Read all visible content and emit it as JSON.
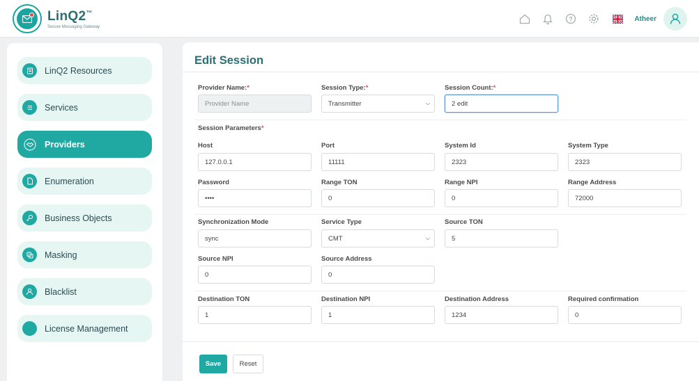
{
  "header": {
    "brand": "LinQ2",
    "brand_sup": "™",
    "tagline": "Secure Messaging Gateway",
    "username": "Atheer",
    "icons": [
      "home-icon",
      "bell-icon",
      "help-icon",
      "gear-icon",
      "uk-flag-icon",
      "user-avatar-icon"
    ]
  },
  "sidebar": {
    "items": [
      {
        "label": "LinQ2 Resources",
        "icon": "resources-icon"
      },
      {
        "label": "Services",
        "icon": "services-icon"
      },
      {
        "label": "Providers",
        "icon": "providers-icon",
        "active": true
      },
      {
        "label": "Enumeration",
        "icon": "document-icon"
      },
      {
        "label": "Business Objects",
        "icon": "key-icon"
      },
      {
        "label": "Masking",
        "icon": "masking-icon"
      },
      {
        "label": "Blacklist",
        "icon": "blocked-user-icon"
      },
      {
        "label": "License Management",
        "icon": "license-icon"
      }
    ]
  },
  "form": {
    "title": "Edit Session",
    "provider_name": {
      "label": "Provider Name:",
      "required": "*",
      "placeholder": "Provider Name"
    },
    "session_type": {
      "label": "Session Type:",
      "required": "*",
      "value": "Transmitter"
    },
    "session_count": {
      "label": "Session Count:",
      "required": "*",
      "value": "2 edit"
    },
    "session_parameters_label": "Session Parameters",
    "session_parameters_required": "*",
    "host": {
      "label": "Host",
      "value": "127.0.0.1"
    },
    "port": {
      "label": "Port",
      "value": "11111"
    },
    "system_id": {
      "label": "System Id",
      "value": "2323"
    },
    "system_type": {
      "label": "System Type",
      "value": "2323"
    },
    "password": {
      "label": "Password",
      "value": "••••"
    },
    "range_ton": {
      "label": "Range TON",
      "value": "0"
    },
    "range_npi": {
      "label": "Range NPI",
      "value": "0"
    },
    "range_address": {
      "label": "Range Address",
      "value": "72000"
    },
    "sync_mode": {
      "label": "Synchronization Mode",
      "value": "sync"
    },
    "service_type": {
      "label": "Service Type",
      "value": "CMT"
    },
    "source_ton": {
      "label": "Source TON",
      "value": "5"
    },
    "source_npi": {
      "label": "Source NPI",
      "value": "0"
    },
    "source_address": {
      "label": "Source Address",
      "value": "0"
    },
    "dest_ton": {
      "label": "Destination TON",
      "value": "1"
    },
    "dest_npi": {
      "label": "Destination NPI",
      "value": "1"
    },
    "dest_address": {
      "label": "Destination Address",
      "value": "1234"
    },
    "required_confirmation": {
      "label": "Required confirmation",
      "value": "0"
    },
    "save_label": "Save",
    "reset_label": "Reset"
  },
  "colors": {
    "accent": "#20a8a2",
    "brand_text": "#2b6f74",
    "nav_bg": "#e5f6f3",
    "required": "#d9534f"
  }
}
